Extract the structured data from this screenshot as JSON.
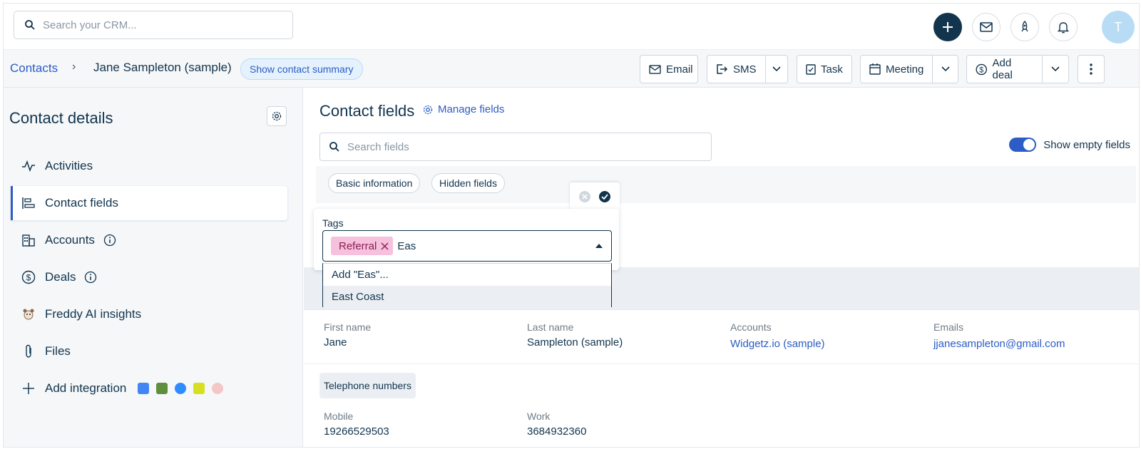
{
  "topbar": {
    "search_placeholder": "Search your CRM...",
    "avatar_initial": "T"
  },
  "breadcrumb": {
    "contacts": "Contacts",
    "separator": "›",
    "name": "Jane Sampleton (sample)",
    "summary_button": "Show contact summary"
  },
  "actions": {
    "email": "Email",
    "sms": "SMS",
    "task": "Task",
    "meeting": "Meeting",
    "add_deal": "Add deal"
  },
  "sidebar": {
    "title": "Contact details",
    "items": [
      {
        "label": "Activities",
        "icon": "activity-icon"
      },
      {
        "label": "Contact fields",
        "icon": "fields-icon"
      },
      {
        "label": "Accounts",
        "icon": "building-icon"
      },
      {
        "label": "Deals",
        "icon": "dollar-icon"
      },
      {
        "label": "Freddy AI insights",
        "icon": "freddy-icon"
      },
      {
        "label": "Files",
        "icon": "paperclip-icon"
      },
      {
        "label": "Add integration",
        "icon": "plus-icon"
      }
    ]
  },
  "main": {
    "title": "Contact fields",
    "manage_fields": "Manage fields",
    "search_placeholder": "Search fields",
    "show_empty_fields": "Show empty fields",
    "filter_pills": [
      "Basic information",
      "Hidden fields"
    ]
  },
  "tag_editor": {
    "label": "Tags",
    "chip": "Referral",
    "typed": "Eas",
    "options": [
      "Add \"Eas\"...",
      "East Coast"
    ]
  },
  "fields": {
    "first_name": {
      "label": "First name",
      "value": "Jane"
    },
    "last_name": {
      "label": "Last name",
      "value": "Sampleton (sample)"
    },
    "accounts": {
      "label": "Accounts",
      "value": "Widgetz.io (sample)"
    },
    "emails": {
      "label": "Emails",
      "value": "jjanesampleton@gmail.com"
    },
    "telephone_section": "Telephone numbers",
    "mobile": {
      "label": "Mobile",
      "value": "19266529503"
    },
    "work": {
      "label": "Work",
      "value": "3684932360"
    }
  },
  "colors": {
    "accent": "#2c5cc5",
    "navy": "#12344d",
    "chip_bg": "#f6c1dd"
  }
}
